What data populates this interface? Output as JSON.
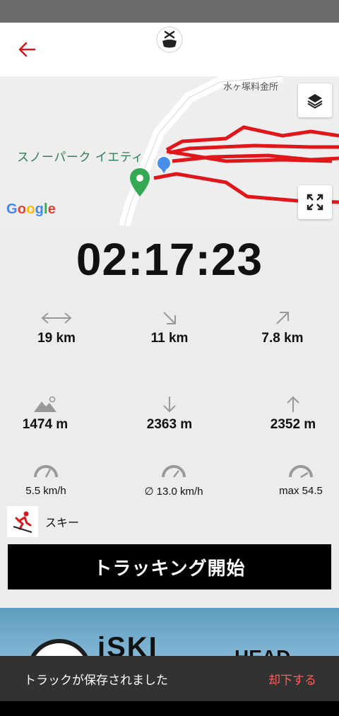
{
  "app": {
    "title": ""
  },
  "map": {
    "toll_label": "水ヶ塚料金所",
    "park_label": "スノーパーク イエティ",
    "google_logo": [
      "G",
      "o",
      "o",
      "g",
      "l",
      "e"
    ],
    "track_color": "#e0161b",
    "marker_color": "#34a853",
    "location_color": "#4a8fe7"
  },
  "timer": {
    "value": "02:17:23"
  },
  "stats": {
    "distance": {
      "icon": "horizontal-arrows-icon",
      "value": "19 km"
    },
    "downhill_distance": {
      "icon": "down-right-arrow-icon",
      "value": "11 km"
    },
    "uphill_distance": {
      "icon": "up-right-arrow-icon",
      "value": "7.8 km"
    },
    "altitude": {
      "icon": "mountain-icon",
      "value": "1474 m"
    },
    "descent": {
      "icon": "down-arrow-icon",
      "value": "2363 m"
    },
    "ascent": {
      "icon": "up-arrow-icon",
      "value": "2352 m"
    },
    "current_speed": {
      "icon": "speedometer-icon",
      "value": "5.5 km/h"
    },
    "average_speed": {
      "icon": "speedometer-icon",
      "value": "∅ 13.0 km/h"
    },
    "max_speed": {
      "icon": "speedometer-icon",
      "value": "max 54.5"
    }
  },
  "activity": {
    "label": "スキー",
    "icon": "skier-icon"
  },
  "tracking_button": {
    "label": "トラッキング開始"
  },
  "ad": {
    "brand": "iSKI",
    "partner": "HEAD"
  },
  "snackbar": {
    "message": "トラックが保存されました",
    "action": "却下する"
  },
  "colors": {
    "accent": "#d7191c",
    "snackbar_action": "#ff5c5c"
  }
}
